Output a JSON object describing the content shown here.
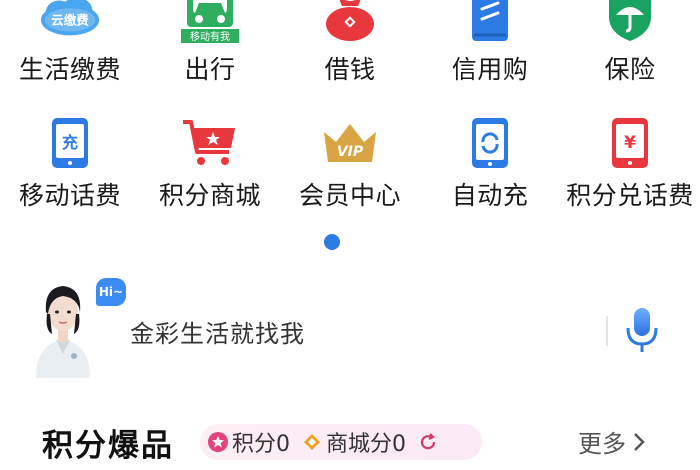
{
  "grid": {
    "row1": [
      {
        "label": "生活缴费",
        "icon": "cloud-bill-icon",
        "badge": "云缴费"
      },
      {
        "label": "出行",
        "icon": "car-icon",
        "badge": "移动有我"
      },
      {
        "label": "借钱",
        "icon": "red-pouch-icon"
      },
      {
        "label": "信用购",
        "icon": "blue-card-icon"
      },
      {
        "label": "保险",
        "icon": "umbrella-shield-icon"
      }
    ],
    "row2": [
      {
        "label": "移动话费",
        "icon": "phone-charge-icon",
        "badge": "充"
      },
      {
        "label": "积分商城",
        "icon": "shopping-cart-icon"
      },
      {
        "label": "会员中心",
        "icon": "vip-crown-icon",
        "badge": "VIP"
      },
      {
        "label": "自动充",
        "icon": "auto-recharge-icon"
      },
      {
        "label": "积分兑话费",
        "icon": "yuan-phone-icon",
        "badge": "¥"
      }
    ]
  },
  "assistant": {
    "hi": "Hi~",
    "text": "金彩生活就找我"
  },
  "section": {
    "title": "积分爆品",
    "points_label": "积分0",
    "mall_points_label": "商城分0",
    "more": "更多"
  },
  "colors": {
    "accent_blue": "#2c7be5",
    "red": "#e8383d",
    "green": "#1aa260",
    "gold": "#d9a441"
  }
}
